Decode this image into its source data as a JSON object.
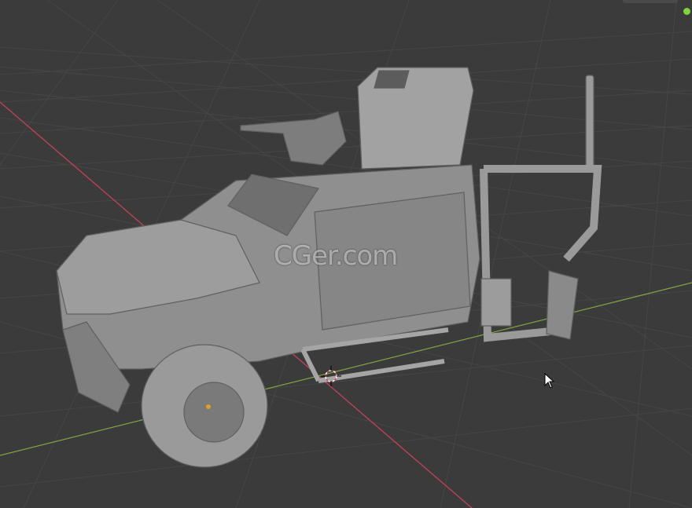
{
  "viewport": {
    "watermark_text": "CGer.com",
    "background_color": "#3b3b3b",
    "grid_color": "#464646",
    "x_axis_color": "#c6405a",
    "y_axis_color": "#7ea83a",
    "status_dot_color": "#7fd33c",
    "model_color": "#8f8f8f",
    "icons": [
      "3d-cursor-icon",
      "mouse-pointer-icon",
      "status-dot-icon"
    ]
  }
}
